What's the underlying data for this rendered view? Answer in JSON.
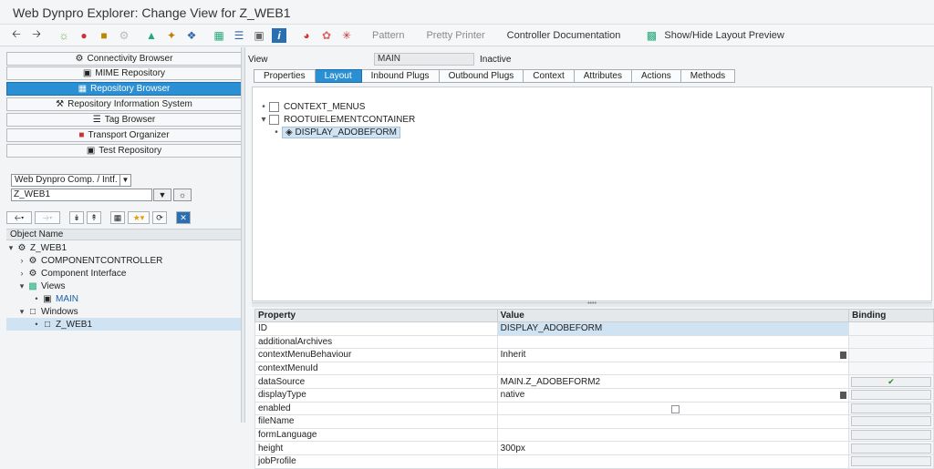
{
  "window": {
    "title": "Web Dynpro Explorer: Change View for Z_WEB1"
  },
  "toolbar": {
    "icons": [
      "back-arrow-icon",
      "forward-arrow-icon",
      "glasses-icon",
      "object-icon",
      "object-list-icon",
      "settings-icon",
      "activate-icon",
      "wizard-icon",
      "where-used-icon",
      "hierarchy-icon",
      "navigator-icon",
      "display-icon",
      "info-icon",
      "pie-icon",
      "test-icon",
      "magic-icon"
    ],
    "pattern": "Pattern",
    "pretty_printer": "Pretty Printer",
    "controller_doc": "Controller Documentation",
    "layout_preview": "Show/Hide Layout Preview"
  },
  "nav": {
    "items": [
      {
        "label": "Connectivity Browser"
      },
      {
        "label": "MIME Repository"
      },
      {
        "label": "Repository Browser"
      },
      {
        "label": "Repository Information System"
      },
      {
        "label": "Tag Browser"
      },
      {
        "label": "Transport Organizer"
      },
      {
        "label": "Test Repository"
      }
    ]
  },
  "object_select": {
    "type": "Web Dynpro Comp. / Intf.",
    "name": "Z_WEB1"
  },
  "object_tree": {
    "header": "Object Name",
    "root": "Z_WEB1",
    "component_controller": "COMPONENTCONTROLLER",
    "component_interface": "Component Interface",
    "views": "Views",
    "main": "MAIN",
    "windows": "Windows",
    "window": "Z_WEB1"
  },
  "view_header": {
    "label": "View",
    "value": "MAIN",
    "status": "Inactive"
  },
  "tabs": [
    "Properties",
    "Layout",
    "Inbound Plugs",
    "Outbound Plugs",
    "Context",
    "Attributes",
    "Actions",
    "Methods"
  ],
  "layout_tree": {
    "context_menus": "CONTEXT_MENUS",
    "root": "ROOTUIELEMENTCONTAINER",
    "child": "DISPLAY_ADOBEFORM"
  },
  "properties": {
    "headers": {
      "property": "Property",
      "value": "Value",
      "binding": "Binding"
    },
    "rows": [
      {
        "property": "ID",
        "value": "DISPLAY_ADOBEFORM"
      },
      {
        "property": "additionalArchives",
        "value": ""
      },
      {
        "property": "contextMenuBehaviour",
        "value": "Inherit"
      },
      {
        "property": "contextMenuId",
        "value": ""
      },
      {
        "property": "dataSource",
        "value": "MAIN.Z_ADOBEFORM2"
      },
      {
        "property": "displayType",
        "value": "native"
      },
      {
        "property": "enabled",
        "value": ""
      },
      {
        "property": "fileName",
        "value": ""
      },
      {
        "property": "formLanguage",
        "value": ""
      },
      {
        "property": "height",
        "value": "300px"
      },
      {
        "property": "jobProfile",
        "value": ""
      }
    ]
  }
}
